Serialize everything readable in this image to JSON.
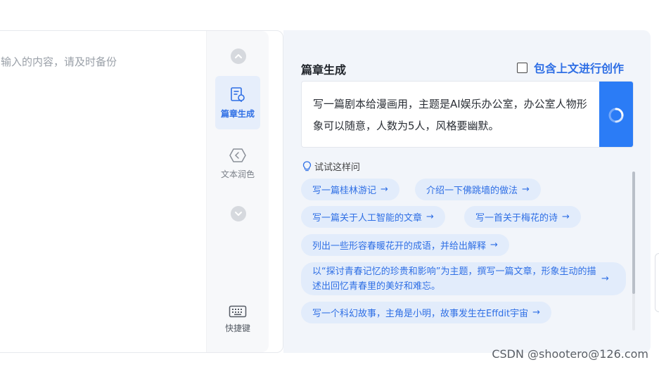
{
  "editor": {
    "placeholder": "输入的内容，请及时备份"
  },
  "rail": {
    "tools": [
      {
        "label": "篇章生成",
        "icon": "article-generate-icon",
        "active": true
      },
      {
        "label": "文本润色",
        "icon": "polish-icon",
        "active": false
      }
    ],
    "shortcut_label": "快捷键"
  },
  "panel": {
    "title": "篇章生成",
    "context_label": "包含上文进行创作",
    "context_checked": false,
    "prompt": "写一篇剧本给漫画用，主题是AI娱乐办公室，办公室人物形象可以随意，人数为5人，风格要幽默。",
    "suggest_title": "试试这样问",
    "suggestions": [
      "写一篇桂林游记",
      "介绍一下佛跳墙的做法",
      "写一篇关于人工智能的文章",
      "写一首关于梅花的诗",
      "列出一些形容春暖花开的成语，并给出解释",
      "以“探讨青春记忆的珍贵和影响”为主题，撰写一篇文章，形象生动的描述出回忆青春里的美好和难忘。",
      "写一个科幻故事，主角是小明，故事发生在Effdit宇宙"
    ]
  },
  "watermark": "CSDN @shootero@126.com",
  "colors": {
    "accent": "#2f6fe5",
    "button": "#2b7cf6",
    "chip_bg": "#e2ecfb"
  }
}
